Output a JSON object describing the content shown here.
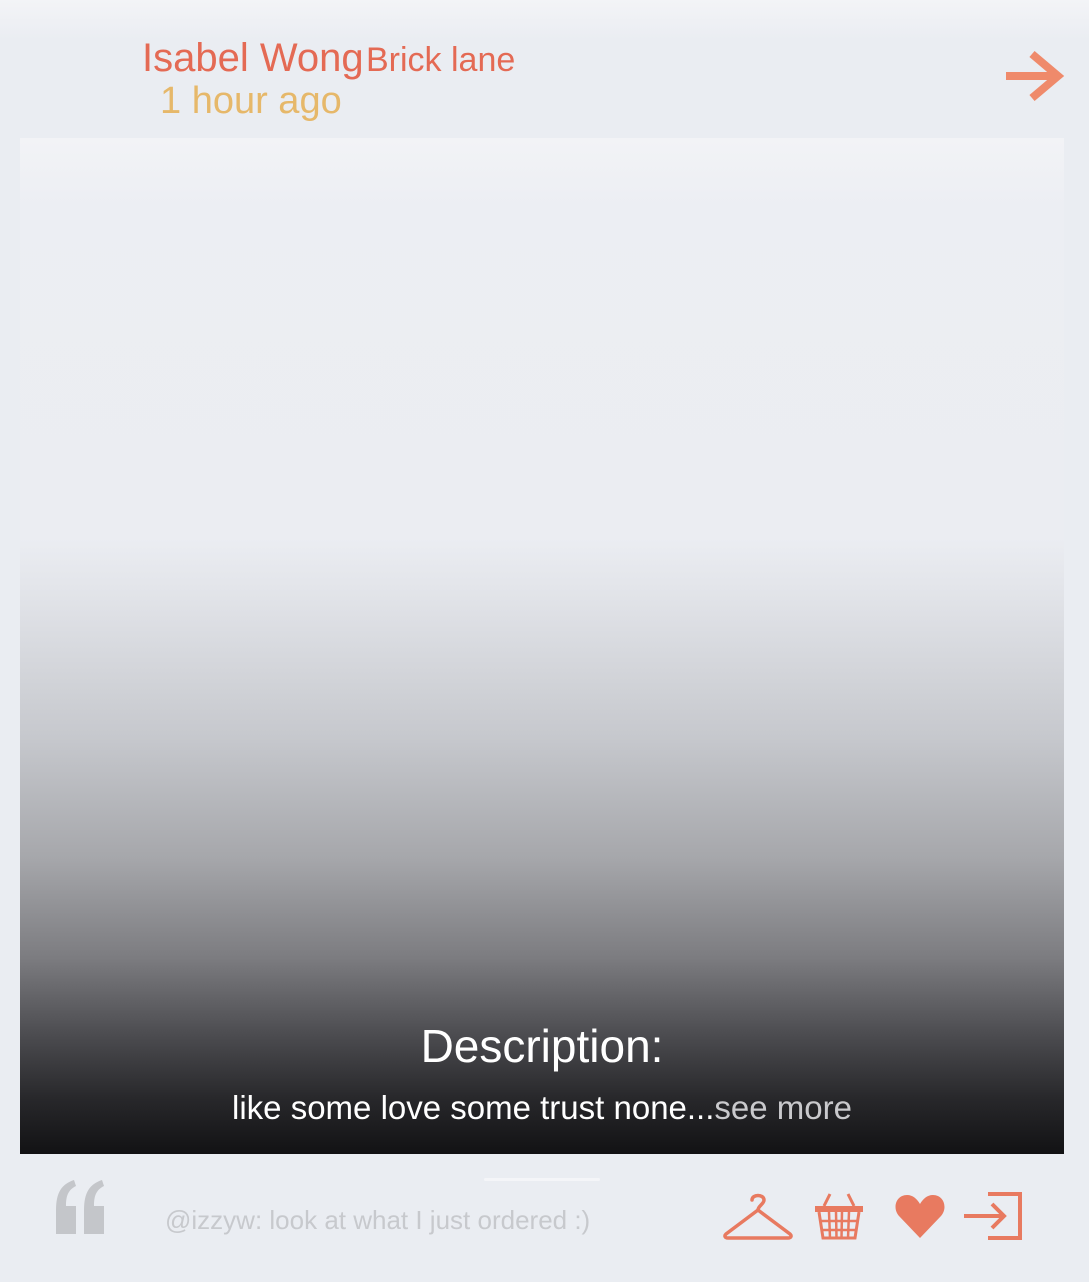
{
  "header": {
    "user_name": "Isabel Wong",
    "location": "Brick lane",
    "timestamp": "1 hour ago",
    "next_icon": "arrow-right-icon"
  },
  "post": {
    "description_title": "Description:",
    "description_text": "like some love some trust none...",
    "see_more_label": "see more"
  },
  "footer": {
    "quote_icon": "quote-icon",
    "comment_text": "@izzyw: look at what I just ordered :)",
    "actions": [
      {
        "name": "hanger-icon"
      },
      {
        "name": "basket-icon"
      },
      {
        "name": "heart-icon"
      },
      {
        "name": "share-icon"
      }
    ]
  },
  "colors": {
    "accent": "#e46a54",
    "accent_light": "#ef8a6b",
    "timestamp": "#e6b86a",
    "background": "#eaedf2",
    "muted_text": "#c7c9cd"
  }
}
